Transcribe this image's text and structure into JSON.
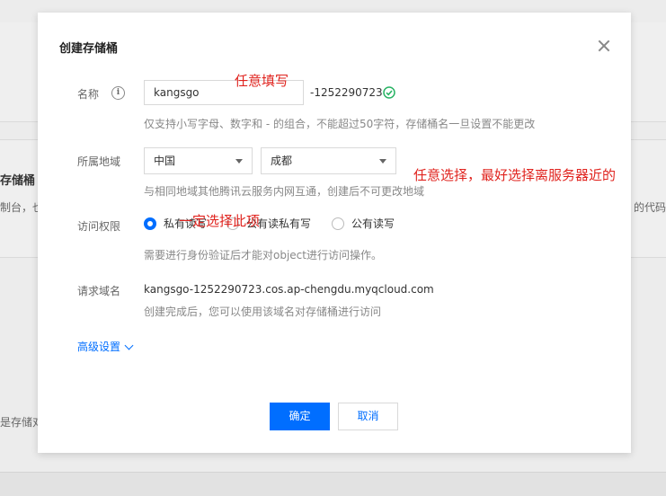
{
  "background": {
    "title": "存储桶",
    "sub_left": "制台，也",
    "sub_right": "的代码",
    "bottom_text": "是存储对"
  },
  "modal": {
    "title": "创建存储桶",
    "name": {
      "label": "名称",
      "value": "kangsgo",
      "suffix": "-1252290723",
      "hint": "仅支持小写字母、数字和 - 的组合，不能超过50字符，存储桶名一旦设置不能更改"
    },
    "region": {
      "label": "所属地域",
      "country": "中国",
      "city": "成都",
      "hint": "与相同地域其他腾讯云服务内网互通，创建后不可更改地域"
    },
    "access": {
      "label": "访问权限",
      "options": [
        "私有读写",
        "公有读私有写",
        "公有读写"
      ],
      "selected": "私有读写",
      "hint": "需要进行身份验证后才能对object进行访问操作。"
    },
    "domain": {
      "label": "请求域名",
      "value": "kangsgo-1252290723.cos.ap-chengdu.myqcloud.com",
      "hint": "创建完成后，您可以使用该域名对存储桶进行访问"
    },
    "advanced_label": "高级设置",
    "confirm_label": "确定",
    "cancel_label": "取消"
  },
  "annotations": {
    "name_note": "任意填写",
    "region_note": "任意选择，最好选择离服务器近的",
    "access_note": "一定选择此项"
  },
  "colors": {
    "accent": "#006eff",
    "annotation": "#e0231e",
    "success": "#29b364"
  }
}
